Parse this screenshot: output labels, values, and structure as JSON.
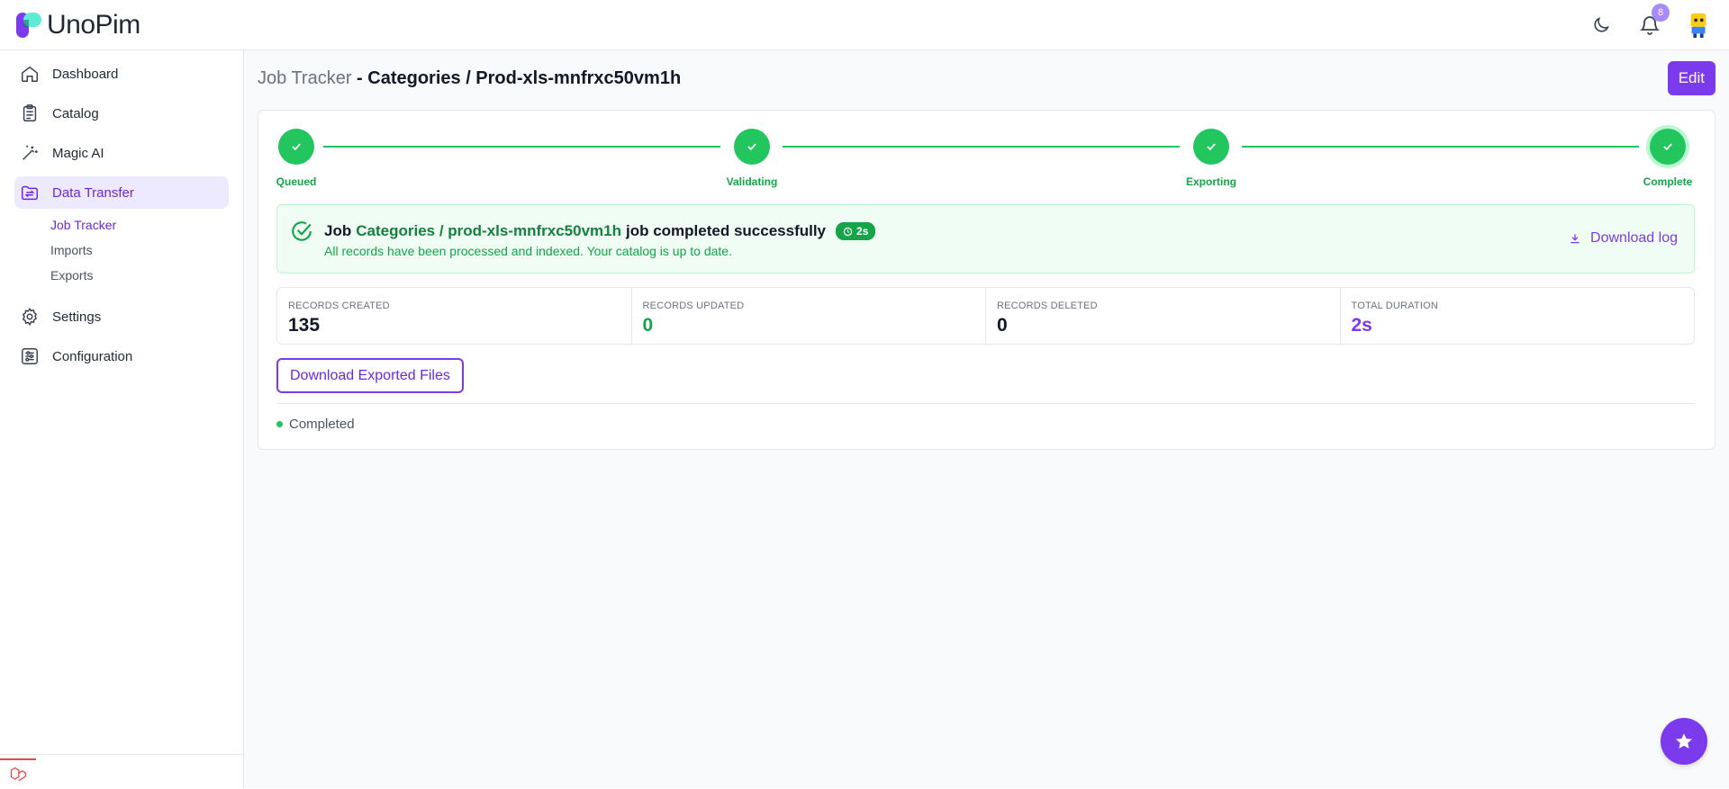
{
  "app": {
    "brand": "UnoPim",
    "notification_count": "8"
  },
  "sidebar": {
    "items": [
      {
        "label": "Dashboard",
        "icon": "home-icon"
      },
      {
        "label": "Catalog",
        "icon": "clipboard-icon"
      },
      {
        "label": "Magic AI",
        "icon": "magic-wand-icon"
      },
      {
        "label": "Data Transfer",
        "icon": "data-transfer-icon",
        "active": true
      },
      {
        "label": "Settings",
        "icon": "gear-icon"
      },
      {
        "label": "Configuration",
        "icon": "sliders-icon"
      }
    ],
    "data_transfer_children": [
      "Job Tracker",
      "Imports",
      "Exports"
    ]
  },
  "page": {
    "title_prefix": "Job Tracker",
    "title_separator": " - ",
    "title_main": "Categories / Prod-xls-mnfrxc50vm1h",
    "edit_label": "Edit"
  },
  "stepper": {
    "steps": [
      "Queued",
      "Validating",
      "Exporting",
      "Complete"
    ]
  },
  "banner": {
    "prefix": "Job",
    "job_name": "Categories / prod-xls-mnfrxc50vm1h",
    "suffix": "job completed successfully",
    "duration": "2s",
    "subtitle": "All records have been processed and indexed. Your catalog is up to date.",
    "download_log": "Download log"
  },
  "stats": [
    {
      "label": "RECORDS CREATED",
      "value": "135"
    },
    {
      "label": "RECORDS UPDATED",
      "value": "0"
    },
    {
      "label": "RECORDS DELETED",
      "value": "0"
    },
    {
      "label": "TOTAL DURATION",
      "value": "2s"
    }
  ],
  "download_files_label": "Download Exported Files",
  "status_label": "Completed",
  "colors": {
    "accent": "#7c3aed",
    "success": "#22c55e"
  }
}
